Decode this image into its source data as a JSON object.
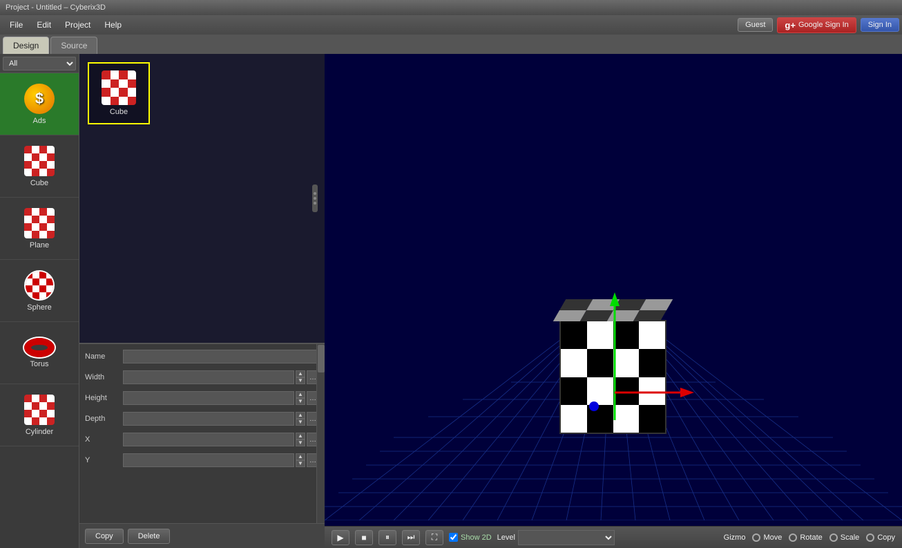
{
  "titlebar": {
    "text": "Project - Untitled – Cyberix3D"
  },
  "menubar": {
    "items": [
      "File",
      "Edit",
      "Project",
      "Help"
    ],
    "auth": {
      "guest_label": "Guest",
      "google_label": "Google Sign In",
      "signin_label": "Sign In"
    }
  },
  "tabs": [
    {
      "id": "design",
      "label": "Design",
      "active": true
    },
    {
      "id": "source",
      "label": "Source",
      "active": false
    }
  ],
  "sidebar": {
    "filter": "All",
    "items": [
      {
        "id": "ads",
        "label": "Ads",
        "type": "ads"
      },
      {
        "id": "cube",
        "label": "Cube",
        "type": "checker"
      },
      {
        "id": "plane",
        "label": "Plane",
        "type": "checker"
      },
      {
        "id": "sphere",
        "label": "Sphere",
        "type": "sphere"
      },
      {
        "id": "torus",
        "label": "Torus",
        "type": "torus"
      },
      {
        "id": "cylinder",
        "label": "Cylinder",
        "type": "checker"
      }
    ]
  },
  "asset_panel": {
    "items": [
      {
        "id": "cube-asset",
        "label": "Cube",
        "selected": true
      }
    ]
  },
  "properties": {
    "fields": [
      {
        "label": "Name",
        "value": ""
      },
      {
        "label": "Width",
        "value": ""
      },
      {
        "label": "Height",
        "value": ""
      },
      {
        "label": "Depth",
        "value": ""
      },
      {
        "label": "X",
        "value": ""
      },
      {
        "label": "Y",
        "value": ""
      }
    ],
    "copy_label": "Copy",
    "delete_label": "Delete"
  },
  "statusbar": {
    "show2d_label": "Show 2D",
    "level_label": "Level",
    "gizmo_label": "Gizmo",
    "move_label": "Move",
    "rotate_label": "Rotate",
    "scale_label": "Scale",
    "copy_label": "Copy",
    "play_icon": "▶",
    "stop_icon": "■",
    "pause_icon": "⏸",
    "forward_icon": "⏭",
    "fullscreen_icon": "⛶"
  }
}
